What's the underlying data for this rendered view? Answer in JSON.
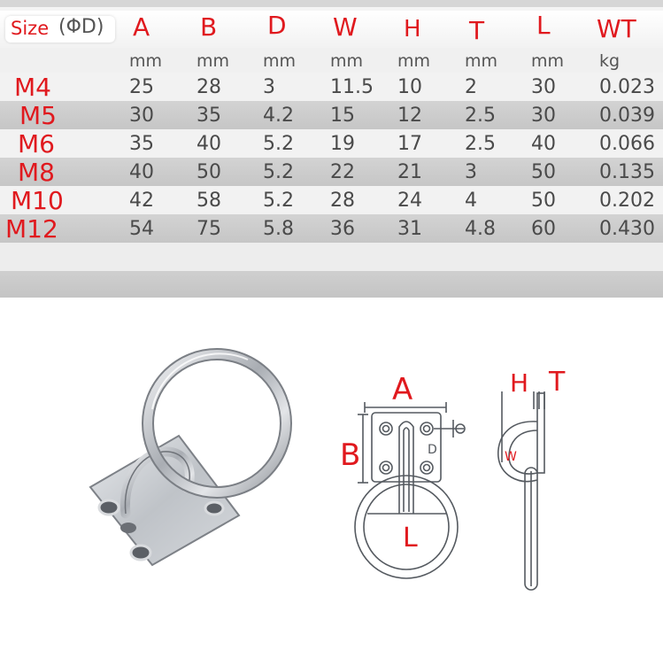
{
  "header": {
    "size_label": "Size",
    "size_dim": "(ΦD)",
    "columns": [
      "A",
      "B",
      "D",
      "W",
      "H",
      "T",
      "L",
      "WT"
    ]
  },
  "units": [
    "mm",
    "mm",
    "mm",
    "mm",
    "mm",
    "mm",
    "mm",
    "kg"
  ],
  "rows": [
    {
      "size": "M4",
      "values": [
        "25",
        "28",
        "3",
        "11.5",
        "10",
        "2",
        "30",
        "0.023"
      ]
    },
    {
      "size": "M5",
      "values": [
        "30",
        "35",
        "4.2",
        "15",
        "12",
        "2.5",
        "30",
        "0.039"
      ]
    },
    {
      "size": "M6",
      "values": [
        "35",
        "40",
        "5.2",
        "19",
        "17",
        "2.5",
        "40",
        "0.066"
      ]
    },
    {
      "size": "M8",
      "values": [
        "40",
        "50",
        "5.2",
        "22",
        "21",
        "3",
        "50",
        "0.135"
      ]
    },
    {
      "size": "M10",
      "values": [
        "42",
        "58",
        "5.2",
        "28",
        "24",
        "4",
        "50",
        "0.202"
      ]
    },
    {
      "size": "M12",
      "values": [
        "54",
        "75",
        "5.8",
        "36",
        "31",
        "4.8",
        "60",
        "0.430"
      ]
    }
  ],
  "diagram": {
    "front_labels": {
      "a": "A",
      "b": "B",
      "d": "D",
      "l": "L"
    },
    "side_labels": {
      "h": "H",
      "t": "T",
      "w": "W"
    }
  },
  "colors": {
    "label_red": "#e0191e",
    "row_shade": "#c9c9c9",
    "steel": "#b8bcc2"
  }
}
